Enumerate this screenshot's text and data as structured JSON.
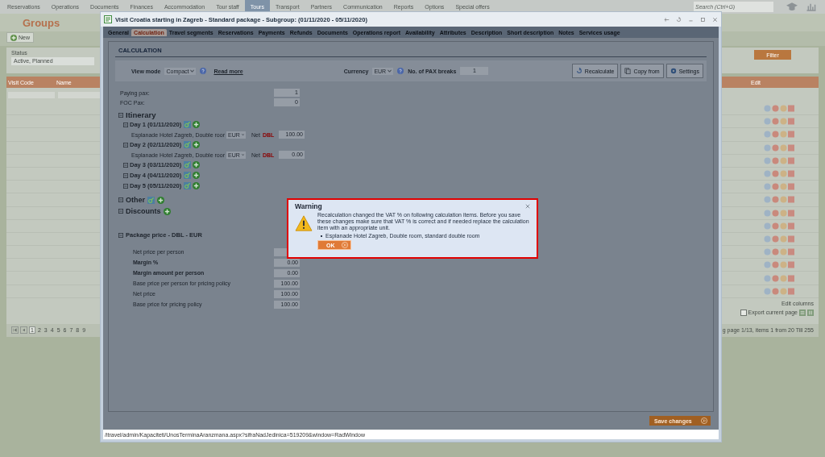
{
  "nav": [
    {
      "label": "Reservations",
      "selected": false
    },
    {
      "label": "Operations",
      "selected": false
    },
    {
      "label": "Documents",
      "selected": false
    },
    {
      "label": "Finances",
      "selected": false
    },
    {
      "label": "Accommodation",
      "selected": false
    },
    {
      "label": "Tour staff",
      "selected": false
    },
    {
      "label": "Tours",
      "selected": true
    },
    {
      "label": "Transport",
      "selected": false
    },
    {
      "label": "Partners",
      "selected": false
    },
    {
      "label": "Communication",
      "selected": false
    },
    {
      "label": "Reports",
      "selected": false
    },
    {
      "label": "Options",
      "selected": false
    },
    {
      "label": "Special offers",
      "selected": false
    }
  ],
  "search": {
    "placeholder": "Search (Ctrl+G)"
  },
  "page": {
    "title": "Groups",
    "new_button": "New",
    "status_label": "Status",
    "status_value": "Active, Planned",
    "filter_button": "Filter",
    "columns": [
      "Visit Code",
      "Name"
    ],
    "edit_column": "Edit",
    "edit_columns": "Edit columns",
    "export_label": "Export current page",
    "export_checked": false,
    "pages": [
      {
        "label": "1",
        "selected": true
      },
      {
        "label": "2",
        "selected": false
      },
      {
        "label": "3",
        "selected": false
      },
      {
        "label": "4",
        "selected": false
      },
      {
        "label": "5",
        "selected": false
      },
      {
        "label": "6",
        "selected": false
      },
      {
        "label": "7",
        "selected": false
      },
      {
        "label": "8",
        "selected": false
      },
      {
        "label": "9",
        "selected": false
      }
    ],
    "pager_info": "g page 1/13, items 1 from 20 Till 255"
  },
  "modal": {
    "title": "Visit Croatia starting in Zagreb - Standard package - Subgroup: (01/11/2020 - 05/11/2020)",
    "tabs": [
      {
        "label": "General",
        "selected": false
      },
      {
        "label": "Calculation",
        "selected": true
      },
      {
        "label": "Travel segments",
        "selected": false
      },
      {
        "label": "Reservations",
        "selected": false
      },
      {
        "label": "Payments",
        "selected": false
      },
      {
        "label": "Refunds",
        "selected": false
      },
      {
        "label": "Documents",
        "selected": false
      },
      {
        "label": "Operations report",
        "selected": false
      },
      {
        "label": "Availability",
        "selected": false
      },
      {
        "label": "Attributes",
        "selected": false
      },
      {
        "label": "Description",
        "selected": false
      },
      {
        "label": "Short description",
        "selected": false
      },
      {
        "label": "Notes",
        "selected": false
      },
      {
        "label": "Services usage",
        "selected": false
      }
    ],
    "section_title": "CALCULATION",
    "view_mode": {
      "label": "View mode",
      "value": "Compact"
    },
    "read_more": "Read more",
    "currency": {
      "label": "Currency",
      "value": "EUR"
    },
    "pax_breaks": {
      "label": "No. of PAX breaks",
      "value": "1"
    },
    "buttons": [
      {
        "label": "Recalculate",
        "kind": "recalc"
      },
      {
        "label": "Copy from",
        "kind": "copy"
      },
      {
        "label": "Settings",
        "kind": "settings"
      }
    ],
    "pax": [
      {
        "label": "Paying pax:",
        "value": "1"
      },
      {
        "label": "FOC Pax:",
        "value": "0"
      }
    ],
    "itinerary": {
      "title": "Itinerary",
      "days": [
        {
          "label": "Day 1 (01/11/2020)",
          "items": [
            {
              "name": "Esplanade Hotel Zagreb, Double roor",
              "currency": "EUR",
              "type": "Net",
              "room": "DBL",
              "value": "100.00"
            }
          ]
        },
        {
          "label": "Day 2 (02/11/2020)",
          "items": [
            {
              "name": "Esplanade Hotel Zagreb, Double roor",
              "currency": "EUR",
              "type": "Net",
              "room": "DBL",
              "value": "0.00"
            }
          ]
        },
        {
          "label": "Day 3 (03/11/2020)"
        },
        {
          "label": "Day 4 (04/11/2020)"
        },
        {
          "label": "Day 5 (05/11/2020)"
        }
      ]
    },
    "other": "Other",
    "discounts": "Discounts",
    "package": {
      "title": "Package price - DBL - EUR",
      "rows": [
        {
          "label": "Net price per person",
          "bold": false
        },
        {
          "label": "Margin %",
          "bold": true,
          "value": "0.00"
        },
        {
          "label": "Margin amount per person",
          "bold": true,
          "value": "0.00"
        },
        {
          "label": "Base price per person for pricing policy",
          "bold": false,
          "value": "100.00"
        },
        {
          "label": "Net price",
          "bold": false,
          "value": "100.00"
        },
        {
          "label": "Base price for pricing policy",
          "bold": false,
          "value": "100.00"
        }
      ]
    },
    "save_button": "Save changes",
    "status_url": "/itravel/admin/Kapaciteti/UnosTerminaAranzmana.aspx?sifraNadJedinica=519209&window=RadWindow"
  },
  "warning": {
    "title": "Warning",
    "message": "Recalculation changed the VAT % on following calculation items. Before you save these changes make sure that VAT % is correct and if needed replace the calculation item with an appropriate unit.",
    "items": [
      "Esplanade Hotel Zagreb, Double room, standard double room"
    ],
    "ok": "OK"
  }
}
